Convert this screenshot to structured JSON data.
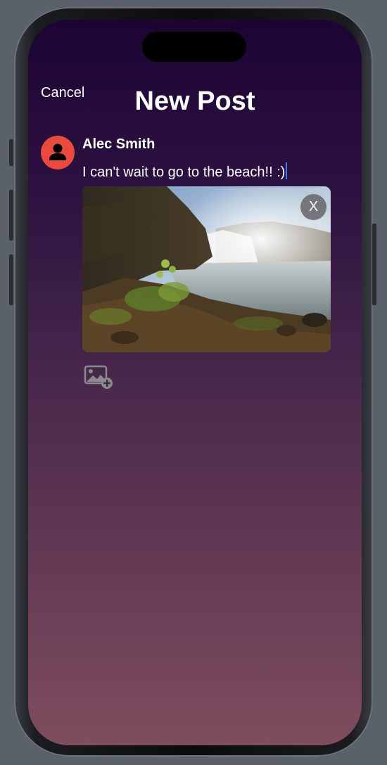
{
  "header": {
    "cancel_label": "Cancel",
    "title": "New Post"
  },
  "post": {
    "author": "Alec Smith",
    "text": "I can't wait to go to the beach!! :)",
    "attachment": {
      "remove_label": "X",
      "image_icon": "waterfall-photo"
    }
  },
  "toolbar": {
    "add_photo_icon": "add-photo-icon"
  },
  "colors": {
    "avatar": "#ea4a3d",
    "caret": "#3b7cff",
    "background_top": "#1c0433",
    "background_bottom": "#7e4d5e"
  }
}
